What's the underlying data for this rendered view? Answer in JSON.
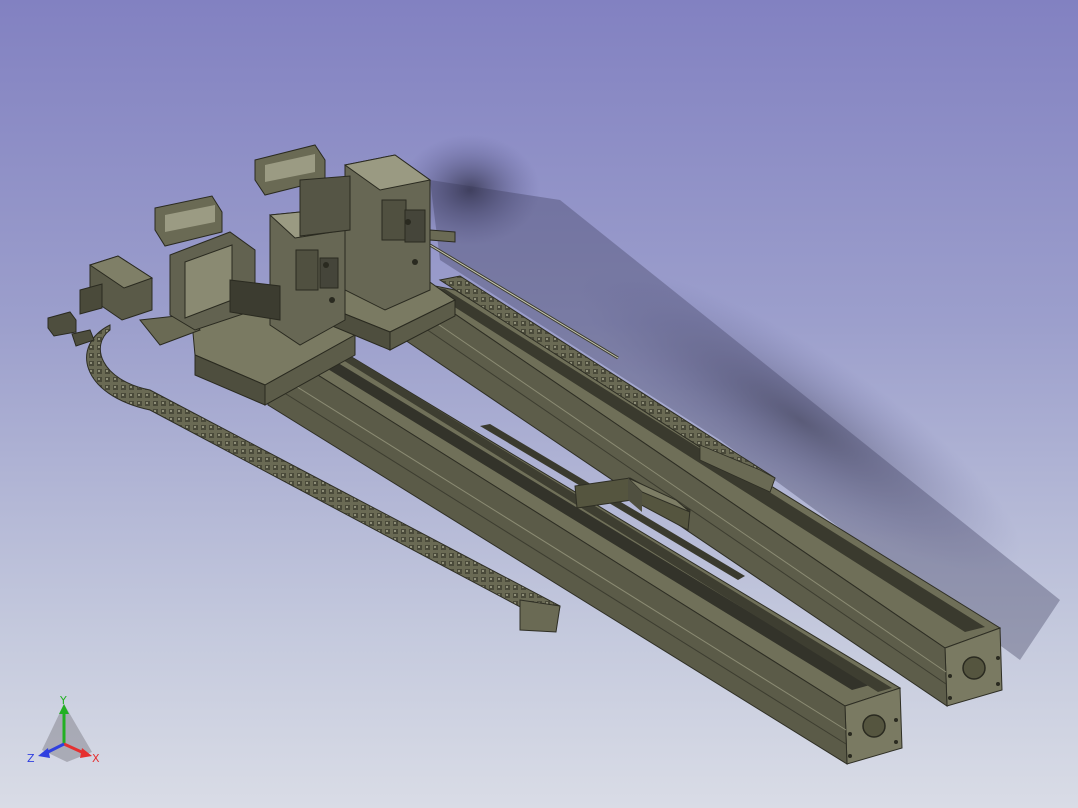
{
  "viewport": {
    "background_top": "#8281c1",
    "background_bottom": "#d9dce6",
    "model_fill": "#6f6f58",
    "model_dark": "#3f3f31",
    "model_light": "#9a9a82"
  },
  "triad": {
    "x_label": "X",
    "y_label": "Y",
    "z_label": "Z",
    "x_color": "#e53030",
    "y_color": "#22b022",
    "z_color": "#3040e0"
  }
}
